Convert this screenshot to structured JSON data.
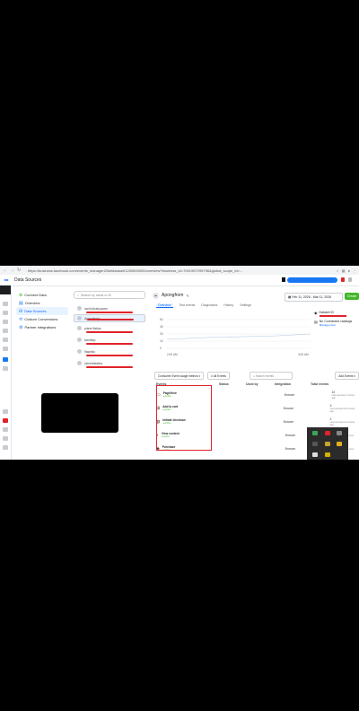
{
  "browser": {
    "url": "https://business.facebook.com/events_manager2/list/dataset/1200500000/overview?business_id=7001957299796&global_scope_id=...",
    "back": "←",
    "forward": "→",
    "reload": "↻",
    "right_icons": [
      "star-icon",
      "extensions-icon",
      "profile-icon",
      "menu-icon"
    ]
  },
  "header": {
    "title": "Data Sources"
  },
  "nav": {
    "items": [
      {
        "icon": "⊕",
        "label": "Connect Data"
      },
      {
        "icon": "▤",
        "label": "Overview"
      },
      {
        "icon": "⛁",
        "label": "Data Sources"
      },
      {
        "icon": "⟲",
        "label": "Custom Conversions"
      },
      {
        "icon": "⚙",
        "label": "Partner integrations"
      }
    ]
  },
  "datasources": {
    "search_placeholder": "Search by name or ID",
    "items": [
      {
        "name": "rachi khatyupam"
      },
      {
        "name": "Apongfrom"
      },
      {
        "name": "plane flabys"
      },
      {
        "name": "farnitlop"
      },
      {
        "name": "fitaphilu"
      },
      {
        "name": "rahimblestea"
      }
    ]
  },
  "main": {
    "pixel_name": "Apongfrom",
    "date_range": "Feb 11, 2026 - Mar 11, 2026",
    "create_label": "Create",
    "tabs": [
      "Overview",
      "Test events",
      "Diagnostics",
      "History",
      "Settings"
    ],
    "chart": {
      "y_ticks": [
        "60",
        "45",
        "30",
        "15",
        "0"
      ],
      "x_start": "2:00 AM",
      "x_end": "3:00 AM"
    },
    "side": {
      "title": "Dataset ID",
      "no_catalog": "No Connected catalogs",
      "manage": "Manage pixel"
    }
  },
  "events": {
    "filter": "Consumer Event usage metrics",
    "events_btn": "All Events",
    "search_placeholder": "Search events",
    "add_events": "Add Events",
    "columns": [
      "Events",
      "Status",
      "Used by",
      "Integration",
      "Total events"
    ],
    "rows": [
      {
        "icon": "▭",
        "name": "PageView",
        "status": "● Active",
        "integration": "Browser",
        "total": "12",
        "sub": "Last received 1 minute ago"
      },
      {
        "icon": "⊞",
        "name": "Add to cart",
        "status": "● Active",
        "integration": "Browser",
        "total": "3",
        "sub": "Last received 30 minutes ago"
      },
      {
        "icon": "◍",
        "name": "Initiate checkout",
        "status": "● Active",
        "integration": "Browser",
        "total": "2",
        "sub": "Last received 41 minutes ago"
      },
      {
        "icon": "◐",
        "name": "View content",
        "status": "● Active",
        "integration": "Browser",
        "total": "1",
        "sub": "Last received 1 hour ago"
      },
      {
        "icon": "◈",
        "name": "Purchase",
        "status": "● Active",
        "integration": "Browser",
        "total": "1",
        "sub": "Last received 1 hour ago"
      }
    ]
  },
  "colors": {
    "accent": "#0866ff",
    "create": "#42b72a",
    "highlight": "#e0242b"
  }
}
